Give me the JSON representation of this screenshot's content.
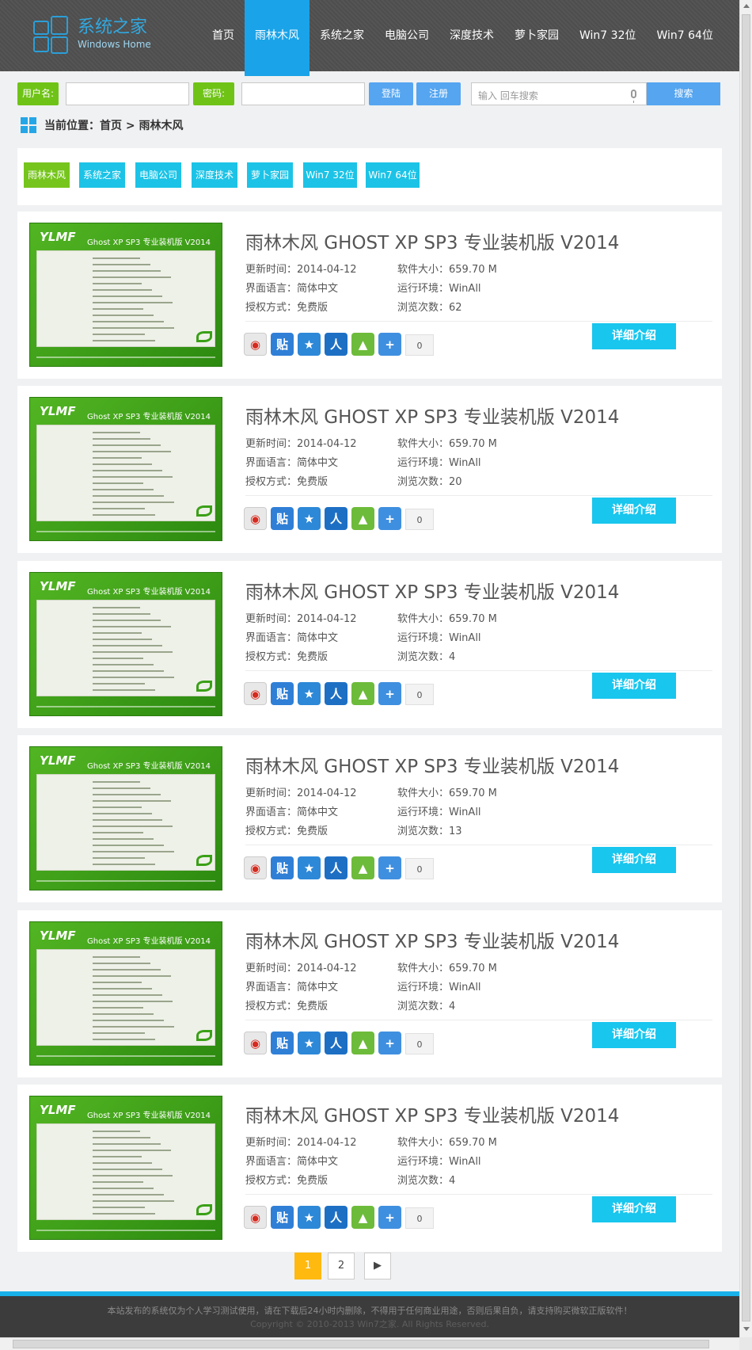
{
  "site": {
    "logo_title": "系统之家",
    "logo_subtitle": "Windows Home"
  },
  "nav": [
    {
      "label": "首页",
      "active": false
    },
    {
      "label": "雨林木风",
      "active": true
    },
    {
      "label": "系统之家",
      "active": false
    },
    {
      "label": "电脑公司",
      "active": false
    },
    {
      "label": "深度技术",
      "active": false
    },
    {
      "label": "萝卜家园",
      "active": false
    },
    {
      "label": "Win7 32位",
      "active": false
    },
    {
      "label": "Win7 64位",
      "active": false
    }
  ],
  "login": {
    "username_label": "用户名:",
    "password_label": "密码:",
    "login_button": "登陆",
    "register_button": "注册",
    "search_placeholder": "输入 回车搜索",
    "search_button": "搜索"
  },
  "breadcrumb": "当前位置：首页 > 雨林木风",
  "categories": [
    {
      "label": "雨林木风",
      "active": true
    },
    {
      "label": "系统之家",
      "active": false
    },
    {
      "label": "电脑公司",
      "active": false
    },
    {
      "label": "深度技术",
      "active": false
    },
    {
      "label": "萝卜家园",
      "active": false
    },
    {
      "label": "Win7 32位",
      "active": false
    },
    {
      "label": "Win7 64位",
      "active": false
    }
  ],
  "items": [
    {
      "title": "雨林木风 GHOST XP SP3 专业装机版 V2014",
      "update": "更新时间：2014-04-12",
      "size": "软件大小：659.70 M",
      "lang": "界面语言：简体中文",
      "env": "运行环境：WinAll",
      "license": "授权方式：免费版",
      "views": "浏览次数：62",
      "share_count": "0",
      "detail": "详细介绍"
    },
    {
      "title": "雨林木风 GHOST XP SP3 专业装机版 V2014",
      "update": "更新时间：2014-04-12",
      "size": "软件大小：659.70 M",
      "lang": "界面语言：简体中文",
      "env": "运行环境：WinAll",
      "license": "授权方式：免费版",
      "views": "浏览次数：20",
      "share_count": "0",
      "detail": "详细介绍"
    },
    {
      "title": "雨林木风 GHOST XP SP3 专业装机版 V2014",
      "update": "更新时间：2014-04-12",
      "size": "软件大小：659.70 M",
      "lang": "界面语言：简体中文",
      "env": "运行环境：WinAll",
      "license": "授权方式：免费版",
      "views": "浏览次数：4",
      "share_count": "0",
      "detail": "详细介绍"
    },
    {
      "title": "雨林木风 GHOST XP SP3 专业装机版 V2014",
      "update": "更新时间：2014-04-12",
      "size": "软件大小：659.70 M",
      "lang": "界面语言：简体中文",
      "env": "运行环境：WinAll",
      "license": "授权方式：免费版",
      "views": "浏览次数：13",
      "share_count": "0",
      "detail": "详细介绍"
    },
    {
      "title": "雨林木风 GHOST XP SP3 专业装机版 V2014",
      "update": "更新时间：2014-04-12",
      "size": "软件大小：659.70 M",
      "lang": "界面语言：简体中文",
      "env": "运行环境：WinAll",
      "license": "授权方式：免费版",
      "views": "浏览次数：4",
      "share_count": "0",
      "detail": "详细介绍"
    },
    {
      "title": "雨林木风 GHOST XP SP3 专业装机版 V2014",
      "update": "更新时间：2014-04-12",
      "size": "软件大小：659.70 M",
      "lang": "界面语言：简体中文",
      "env": "运行环境：WinAll",
      "license": "授权方式：免费版",
      "views": "浏览次数：4",
      "share_count": "0",
      "detail": "详细介绍"
    }
  ],
  "thumbnail": {
    "brand": "YLMF",
    "title": "Ghost XP SP3 专业装机版 V2014"
  },
  "share_icons": [
    {
      "name": "weibo-icon",
      "glyph": "◉",
      "color": "#e8e8e8"
    },
    {
      "name": "tieba-icon",
      "glyph": "贴",
      "color": "#2f7fd6"
    },
    {
      "name": "qzone-icon",
      "glyph": "★",
      "color": "#2d88d8"
    },
    {
      "name": "renren-icon",
      "glyph": "人",
      "color": "#1d6fc4"
    },
    {
      "name": "kaixin-icon",
      "glyph": "▲",
      "color": "#6dbb3a"
    },
    {
      "name": "more-icon",
      "glyph": "+",
      "color": "#3f8fe0"
    }
  ],
  "pagination": [
    {
      "label": "1",
      "active": true
    },
    {
      "label": "2",
      "active": false
    },
    {
      "label": "▶",
      "active": false
    }
  ],
  "footer": {
    "line1": "本站发布的系统仅为个人学习测试使用，请在下载后24小时内删除，不得用于任何商业用途，否则后果自负，请支持购买微软正版软件！",
    "line2": "Copyright © 2010-2013 Win7之家. All Rights Reserved."
  }
}
